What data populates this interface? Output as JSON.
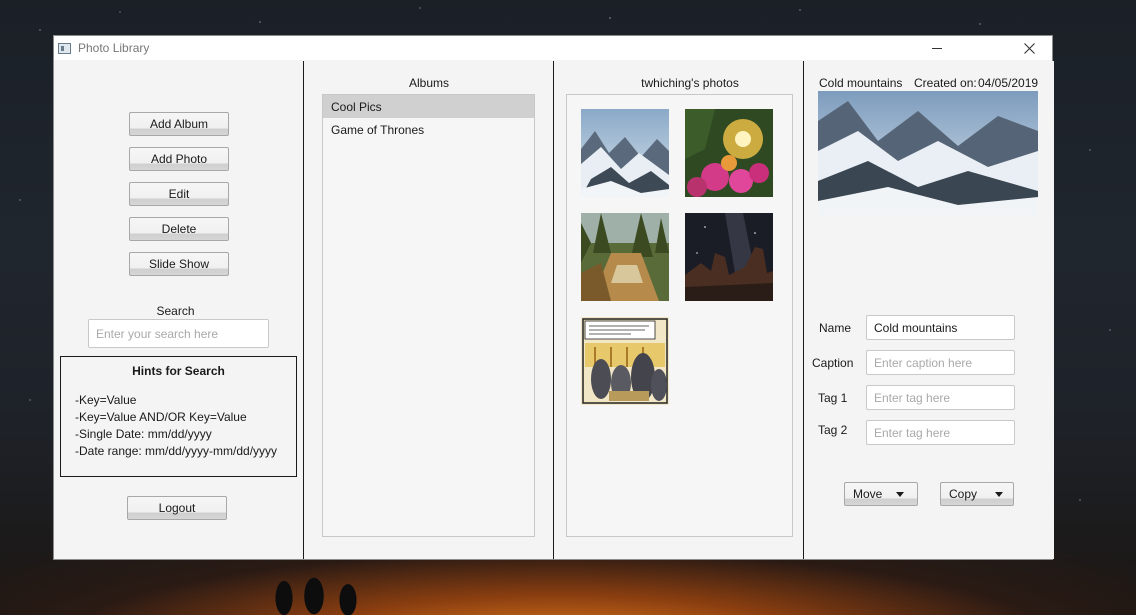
{
  "window": {
    "title": "Photo Library"
  },
  "left": {
    "buttons": [
      "Add Album",
      "Add Photo",
      "Edit",
      "Delete",
      "Slide Show"
    ],
    "search_label": "Search",
    "search_placeholder": "Enter your search here",
    "hints_title": "Hints for Search",
    "hints": [
      "-Key=Value",
      "-Key=Value AND/OR Key=Value",
      "-Single Date: mm/dd/yyyy",
      "-Date range: mm/dd/yyyy-mm/dd/yyyy"
    ],
    "logout": "Logout"
  },
  "albums": {
    "title": "Albums",
    "items": [
      "Cool Pics",
      "Game of Thrones"
    ],
    "selected": "Cool Pics"
  },
  "photos": {
    "title": "twhiching's photos",
    "thumbnails": [
      "mountain-snow",
      "sunset-flowers",
      "forest-river",
      "milky-way-night",
      "comic-strip"
    ]
  },
  "detail": {
    "photo_name": "Cold mountains",
    "created_label": "Created on:",
    "created_date": "04/05/2019",
    "fields": {
      "name_label": "Name",
      "name_value": "Cold mountains",
      "caption_label": "Caption",
      "caption_placeholder": "Enter caption here",
      "tag1_label": "Tag 1",
      "tag1_placeholder": "Enter tag here",
      "tag2_label": "Tag 2",
      "tag2_placeholder": "Enter tag here"
    },
    "move": "Move",
    "copy": "Copy"
  }
}
